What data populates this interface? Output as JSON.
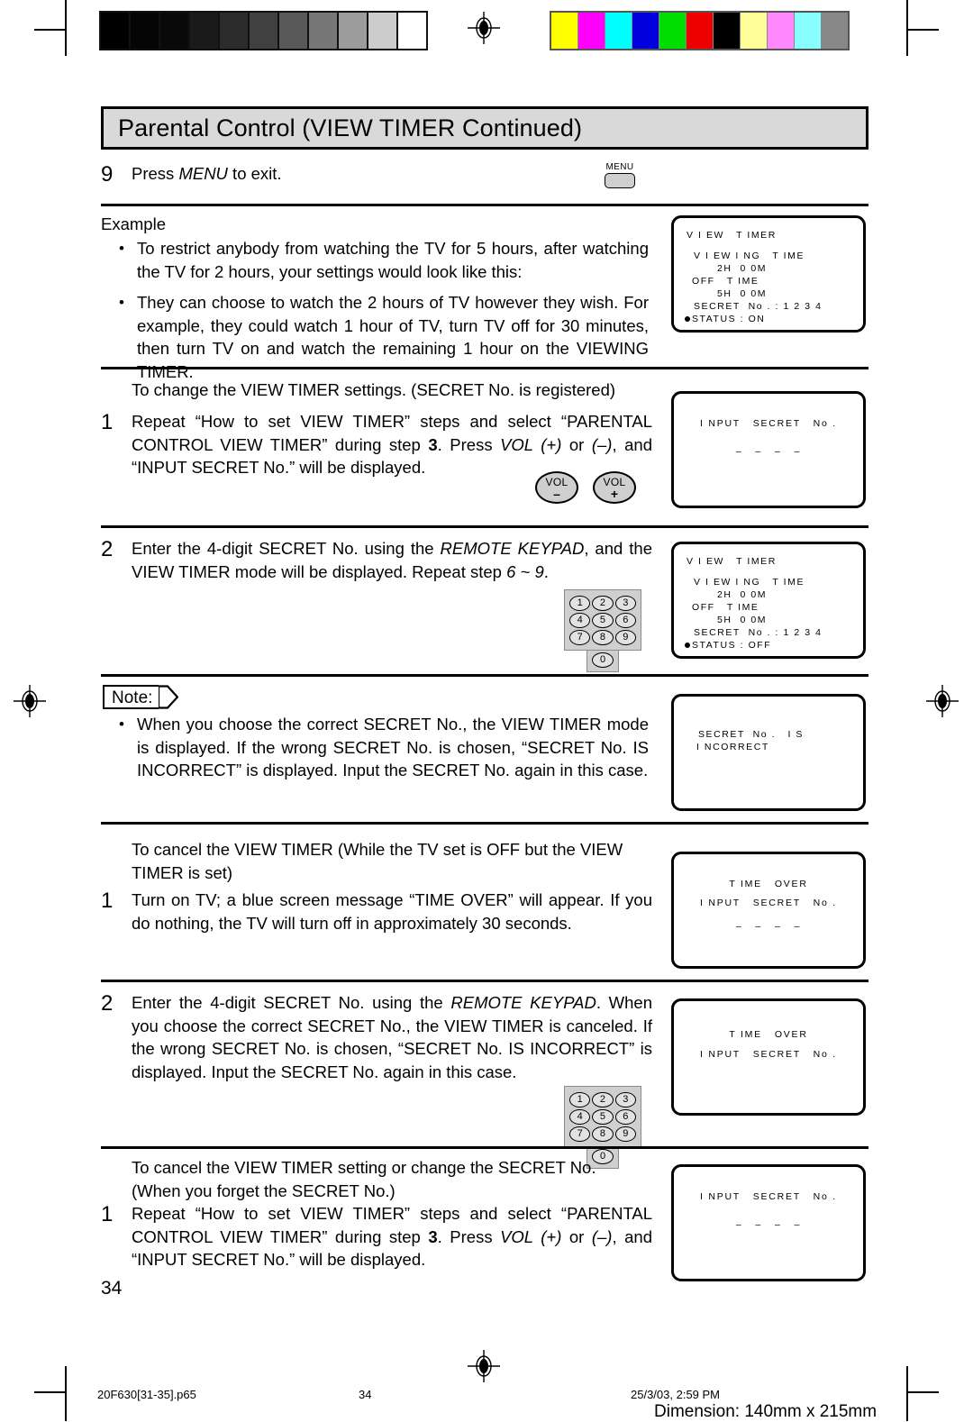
{
  "header": {
    "title": "Parental Control (VIEW TIMER Continued)"
  },
  "steps": {
    "menu_step": {
      "num": "9",
      "text_a": "Press ",
      "text_b": "MENU",
      "text_c": " to exit."
    },
    "example_heading": "Example",
    "example_bullets": [
      "To restrict anybody from watching the TV for 5 hours, after watching the TV for 2 hours, your settings would look like this:",
      "They can choose to watch the 2 hours of TV however they wish. For example, they could watch 1 hour of TV, turn TV off for 30 minutes, then turn TV on and watch the remaining 1 hour on the VIEWING TIMER."
    ],
    "change_heading": "To change the VIEW TIMER settings. (SECRET No. is registered)",
    "change_step1": {
      "num": "1",
      "p1": "Repeat “How to set VIEW TIMER” steps and select “PARENTAL CONTROL VIEW TIMER” during step ",
      "bold": "3",
      "p2": ". Press ",
      "ital": "VOL (+)",
      "p3": " or ",
      "ital2": "(–)",
      "p4": ", and “INPUT SECRET No.” will be displayed."
    },
    "change_step2": {
      "num": "2",
      "p1": "Enter the 4-digit SECRET No. using the ",
      "ital": "REMOTE KEYPAD",
      "p2": ", and the VIEW TIMER mode will be displayed. Repeat step ",
      "ital2": "6 ~ 9",
      "p3": "."
    },
    "note_label": "Note:",
    "note_bullets": [
      "When you choose the correct SECRET No., the VIEW TIMER mode is displayed. If the wrong SECRET No. is chosen, “SECRET No. IS INCORRECT” is displayed. Input the SECRET No. again in this case."
    ],
    "cancel_heading": "To cancel the VIEW TIMER (While the TV set is OFF but the VIEW TIMER is set)",
    "cancel_step1": {
      "num": "1",
      "text": "Turn on TV; a blue screen message “TIME OVER” will appear. If you do nothing, the TV will turn off in approximately 30 seconds."
    },
    "cancel_step2": {
      "num": "2",
      "p1": "Enter the 4-digit SECRET No. using the ",
      "ital": "REMOTE KEYPAD",
      "p2": ". When you choose the correct SECRET No., the VIEW TIMER is canceled. If the wrong SECRET No. is chosen, “SECRET No. IS INCORRECT” is displayed. Input the SECRET No. again in this case."
    },
    "forget_heading": "To cancel the VIEW TIMER setting or change the SECRET No. (When you forget the SECRET No.)",
    "forget_step1": {
      "num": "1",
      "p1": "Repeat “How to set VIEW TIMER” steps and select “PARENTAL CONTROL VIEW TIMER” during step ",
      "bold": "3",
      "p2": ". Press ",
      "ital": "VOL (+)",
      "p3": " or ",
      "ital2": "(–)",
      "p4": ", and “INPUT SECRET No.” will be displayed."
    }
  },
  "osd_screens": [
    {
      "name": "view-timer-status-on",
      "lines": [
        "V I EW   T IMER",
        "V I EW I NG   T IME",
        "2H  0 0M",
        "OFF   T IME",
        "5H  0 0M",
        "SECRET  No . : 1 2 3 4",
        "STATUS : ON"
      ]
    },
    {
      "name": "input-secret-no-1",
      "lines": [
        "I NPUT   SECRET   No .",
        "–   –   –   –"
      ]
    },
    {
      "name": "view-timer-status-off",
      "lines": [
        "V I EW   T IMER",
        "V I EW I NG   T IME",
        "2H  0 0M",
        "OFF   T IME",
        "5H  0 0M",
        "SECRET  No . : 1 2 3 4",
        "STATUS : OFF"
      ]
    },
    {
      "name": "secret-no-incorrect",
      "lines": [
        "SECRET  No .   I S",
        "I NCORRECT"
      ]
    },
    {
      "name": "time-over-input-secret-1",
      "lines": [
        "T IME   OVER",
        "I NPUT   SECRET   No .",
        "–   –   –   –"
      ]
    },
    {
      "name": "time-over-input-secret-2",
      "lines": [
        "T IME   OVER",
        "I NPUT   SECRET   No ."
      ]
    },
    {
      "name": "input-secret-no-2",
      "lines": [
        "I NPUT   SECRET   No .",
        "–   –   –   –"
      ]
    }
  ],
  "controls": {
    "menu_button_label": "MENU",
    "vol_minus": {
      "top": "VOL",
      "sign": "–"
    },
    "vol_plus": {
      "top": "VOL",
      "sign": "+"
    },
    "keypad_rows": [
      [
        "1",
        "2",
        "3"
      ],
      [
        "4",
        "5",
        "6"
      ],
      [
        "7",
        "8",
        "9"
      ]
    ],
    "keypad_zero": "0"
  },
  "footer": {
    "page_number": "34",
    "file_name": "20F630[31-35].p65",
    "footer_page": "34",
    "timestamp": "25/3/03, 2:59 PM",
    "dimension": "Dimension: 140mm x 215mm"
  },
  "calibration": {
    "gray_steps": [
      "#000000",
      "#050505",
      "#0a0a0a",
      "#1a1a1a",
      "#2b2b2b",
      "#404040",
      "#595959",
      "#777777",
      "#9c9c9c",
      "#cccccc",
      "#ffffff"
    ],
    "color_steps": [
      "#ffff00",
      "#ff00ff",
      "#00ffff",
      "#0000dd",
      "#00dd00",
      "#ee0000",
      "#000000",
      "#ffff99",
      "#ff88ff",
      "#88ffff",
      "#888888"
    ]
  }
}
